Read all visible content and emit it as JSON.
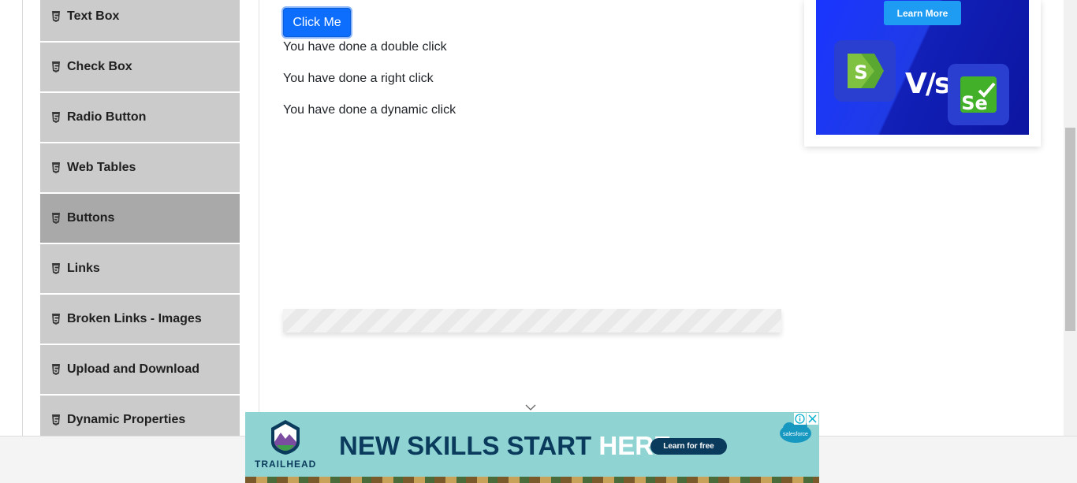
{
  "sidebar": {
    "items": [
      {
        "label": "Text Box",
        "active": false
      },
      {
        "label": "Check Box",
        "active": false
      },
      {
        "label": "Radio Button",
        "active": false
      },
      {
        "label": "Web Tables",
        "active": false
      },
      {
        "label": "Buttons",
        "active": true
      },
      {
        "label": "Links",
        "active": false
      },
      {
        "label": "Broken Links - Images",
        "active": false
      },
      {
        "label": "Upload and Download",
        "active": false
      },
      {
        "label": "Dynamic Properties",
        "active": false
      }
    ]
  },
  "main": {
    "click_button_label": "Click Me",
    "messages": {
      "double": "You have done a double click",
      "right": "You have done a right click",
      "dynamic": "You have done a dynamic click"
    }
  },
  "right_ad": {
    "cta_label": "Learn More",
    "vs_text": "V/s",
    "logo_left_text": "S",
    "logo_right_text": "Se"
  },
  "bottom_ad": {
    "brand": "TRAILHEAD",
    "headline_main": "NEW SKILLS START ",
    "headline_accent": "HERE.",
    "cta_label": "Learn for free",
    "partner": "salesforce"
  },
  "colors": {
    "primary_button": "#0d6efd",
    "sidebar_item": "#cbcbcb",
    "sidebar_active": "#a9a9a9",
    "ad_teal": "#8fd3d3",
    "ad_navy": "#0b3b5c"
  }
}
